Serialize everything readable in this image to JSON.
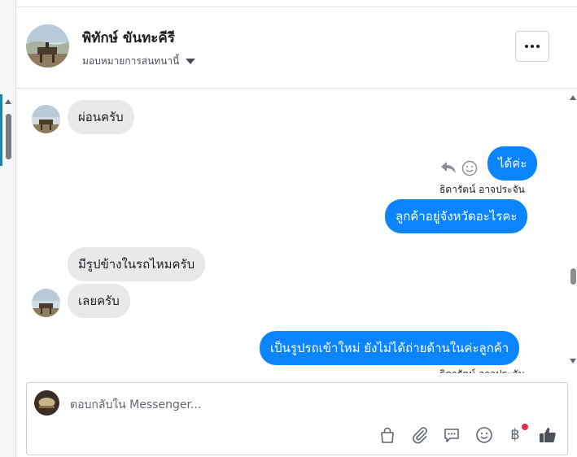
{
  "header": {
    "name": "พิทักษ์ ขันทะคีรี",
    "assign_label": "มอบหมายการสนทนานี้"
  },
  "messages": [
    {
      "direction": "in",
      "text": "ผ่อนครับ"
    },
    {
      "direction": "out",
      "text": "ได้ค่ะ",
      "sender": "ธิดารัตน์ อาจประจัน"
    },
    {
      "direction": "out",
      "text": "ลูกค้าอยู่จังหวัดอะไรคะ"
    },
    {
      "direction": "in",
      "text": "มีรูปข้างในรถไหมครับ"
    },
    {
      "direction": "in",
      "text": "เลยครับ"
    },
    {
      "direction": "out",
      "text": "เป็นรูปรถเข้าใหม่ ยังไม่ได้ถ่ายด้านในค่ะลูกค้า",
      "sender": "ธิดารัตน์ อาจประจัน"
    }
  ],
  "composer": {
    "placeholder": "ตอบกลับใน Messenger...",
    "baht_symbol": "฿"
  },
  "colors": {
    "outgoing_bubble": "#0b84ff",
    "incoming_bubble": "#e9e9eb",
    "notification_dot": "#f02849",
    "sidebar_accent": "#1a86a8"
  },
  "icons": [
    "more-options-icon",
    "chevron-down-icon",
    "reply-icon",
    "emoji-reaction-icon",
    "shopping-bag-icon",
    "paperclip-icon",
    "saved-reply-icon",
    "emoji-icon",
    "baht-payment-icon",
    "thumbs-up-icon"
  ]
}
